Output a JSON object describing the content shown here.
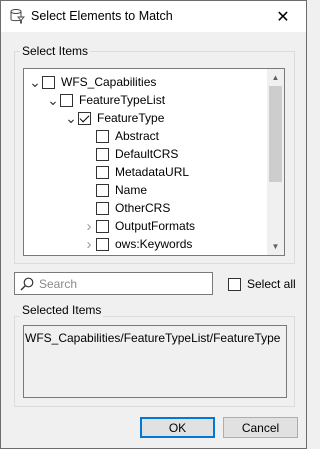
{
  "window": {
    "title": "Select Elements to Match",
    "close_symbol": "✕"
  },
  "select_items": {
    "group_label": "Select Items",
    "tree": [
      {
        "label": "WFS_Capabilities",
        "depth": 0,
        "arrow": "expanded",
        "checked": false
      },
      {
        "label": "FeatureTypeList",
        "depth": 1,
        "arrow": "expanded",
        "checked": false
      },
      {
        "label": "FeatureType",
        "depth": 2,
        "arrow": "expanded",
        "checked": true
      },
      {
        "label": "Abstract",
        "depth": 3,
        "arrow": "none",
        "checked": false
      },
      {
        "label": "DefaultCRS",
        "depth": 3,
        "arrow": "none",
        "checked": false
      },
      {
        "label": "MetadataURL",
        "depth": 3,
        "arrow": "none",
        "checked": false
      },
      {
        "label": "Name",
        "depth": 3,
        "arrow": "none",
        "checked": false
      },
      {
        "label": "OtherCRS",
        "depth": 3,
        "arrow": "none",
        "checked": false
      },
      {
        "label": "OutputFormats",
        "depth": 3,
        "arrow": "collapsed",
        "checked": false
      },
      {
        "label": "ows:Keywords",
        "depth": 3,
        "arrow": "collapsed",
        "checked": false
      }
    ]
  },
  "search": {
    "placeholder": "Search",
    "value": ""
  },
  "select_all": {
    "label": "Select all",
    "checked": false
  },
  "selected_items": {
    "group_label": "Selected Items",
    "value": "WFS_Capabilities/FeatureTypeList/FeatureType"
  },
  "buttons": {
    "ok": "OK",
    "cancel": "Cancel"
  }
}
